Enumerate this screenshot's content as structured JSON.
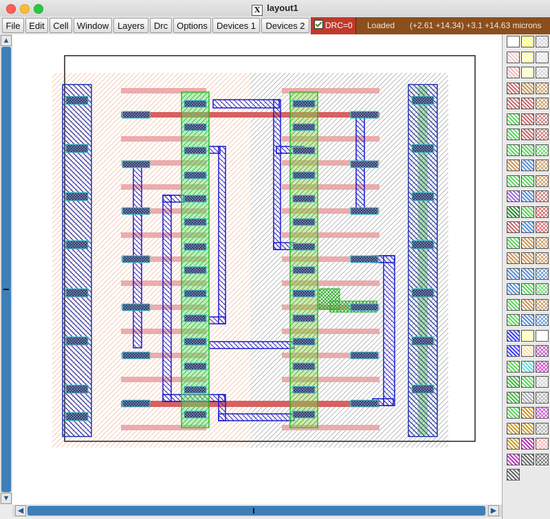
{
  "window": {
    "title": "layout1"
  },
  "menu": {
    "items": [
      "File",
      "Edit",
      "Cell",
      "Window",
      "Layers",
      "Drc",
      "Options",
      "Devices 1",
      "Devices 2"
    ]
  },
  "status": {
    "drc": "DRC=0",
    "drc_checked": true,
    "loaded": "Loaded",
    "coords": "(+2.61 +14.34) +3.1 +14.63 microns"
  },
  "palette": {
    "colors": [
      "#ffffff",
      "#ffff66",
      "#cccccc",
      "#f0c8c8",
      "#ffff99",
      "#dddddd",
      "#f2b8b8",
      "#ffffaa",
      "#cccccc",
      "#c86a6a",
      "#c8955a",
      "#c8955a",
      "#c86a6a",
      "#c86a6a",
      "#c8955a",
      "#5fd35f",
      "#c86a6a",
      "#c86a6a",
      "#5fd35f",
      "#c86a6a",
      "#c86a6a",
      "#5fd35f",
      "#5fd35f",
      "#5fd35f",
      "#c8955a",
      "#5b8fd6",
      "#c8955a",
      "#5fd35f",
      "#5fd35f",
      "#c8955a",
      "#9a6adc",
      "#5b8fd6",
      "#c86a6a",
      "#2a8a2a",
      "#5fd35f",
      "#e05555",
      "#c86a6a",
      "#5b8fd6",
      "#e05555",
      "#5fd35f",
      "#c8955a",
      "#c8955a",
      "#c8955a",
      "#c8955a",
      "#c8955a",
      "#5b8fd6",
      "#5b8fd6",
      "#5b8fd6",
      "#5b8fd6",
      "#5fd35f",
      "#5fd35f",
      "#5fd35f",
      "#c8955a",
      "#c8955a",
      "#5fd35f",
      "#5b8fd6",
      "#5b8fd6",
      "#3a3aff",
      "#ffff99",
      "#ffffff",
      "#3a3aff",
      "#ffddaa",
      "#bb44bb",
      "#5fd35f",
      "#66dddd",
      "#cc33cc",
      "#44bb44",
      "#5fd35f",
      "#cccccc",
      "#44bb44",
      "#aaaaaa",
      "#aaaaaa",
      "#5fd35f",
      "#cc9933",
      "#cc44cc",
      "#cc9933",
      "#cc9933",
      "#aaaaaa",
      "#cc9933",
      "#bb33bb",
      "#ffaaaa",
      "#bb33bb",
      "#666666",
      "#666666",
      "#666666"
    ]
  }
}
